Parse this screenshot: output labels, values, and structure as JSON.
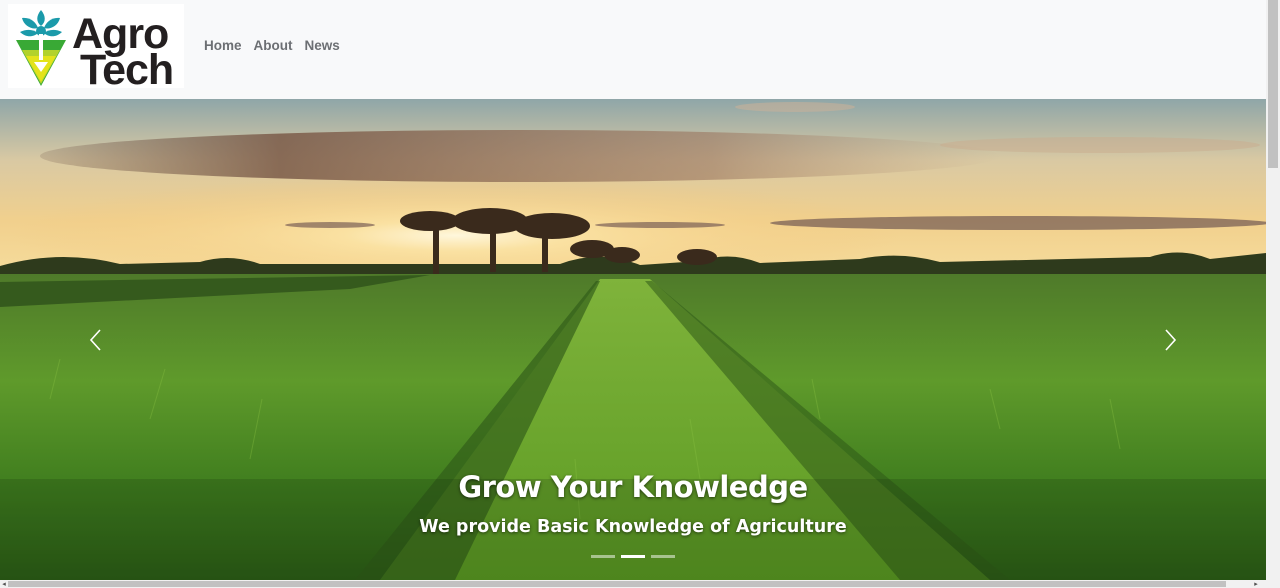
{
  "brand": {
    "name_line1": "Agro",
    "name_line2": "Tech",
    "logo_colors": {
      "teal": "#1b9aaa",
      "green": "#39a935",
      "yellow": "#e3e31b",
      "text": "#231f20"
    }
  },
  "nav": {
    "items": [
      {
        "label": "Home"
      },
      {
        "label": "About"
      },
      {
        "label": "News"
      }
    ]
  },
  "carousel": {
    "slide": {
      "image_icon": "wheat-field-sunset-photo",
      "title": "Grow Your Knowledge",
      "text": "We provide Basic Knowledge of Agriculture"
    },
    "indicator_count": 3,
    "active_index": 1,
    "prev_icon": "chevron-left-icon",
    "next_icon": "chevron-right-icon"
  },
  "scrollbars": {
    "vertical_position": 0,
    "horizontal_position": 0
  }
}
